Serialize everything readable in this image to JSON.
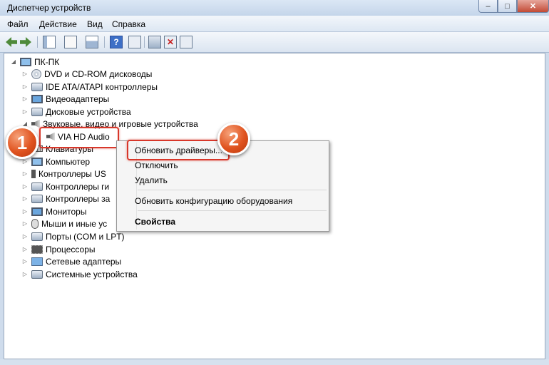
{
  "window": {
    "title": "Диспетчер устройств",
    "controls": [
      "minimize-icon",
      "maximize-icon",
      "close-icon"
    ]
  },
  "menu": [
    "Файл",
    "Действие",
    "Вид",
    "Справка"
  ],
  "toolbar": {
    "buttons": [
      "back-arrow-icon",
      "forward-arrow-icon",
      "show-hide-tree-icon",
      "properties-icon",
      "console-tree-icon",
      "help-icon",
      "scan-hardware-icon",
      "update-driver-icon",
      "disable-device-icon",
      "uninstall-device-icon"
    ]
  },
  "tree": {
    "root": "ПК-ПК",
    "items": [
      "DVD и CD-ROM дисководы",
      "IDE ATA/ATAPI контроллеры",
      "Видеоадаптеры",
      "Дисковые устройства",
      "Звуковые, видео и игровые устройства",
      "VIA HD Audio",
      "Клавиатуры",
      "Компьютер",
      "Контроллеры US",
      "Контроллеры ги",
      "Контроллеры за",
      "Мониторы",
      "Мыши и иные ус",
      "Порты (COM и LPT)",
      "Процессоры",
      "Сетевые адаптеры",
      "Системные устройства"
    ]
  },
  "context_menu": {
    "items": [
      "Обновить драйверы...",
      "Отключить",
      "Удалить",
      "Обновить конфигурацию оборудования",
      "Свойства"
    ]
  },
  "badges": [
    "1",
    "2"
  ],
  "colors": {
    "accent": "#e0531f",
    "highlight_border": "#d8372a",
    "window_frame": "#cfdcec"
  }
}
